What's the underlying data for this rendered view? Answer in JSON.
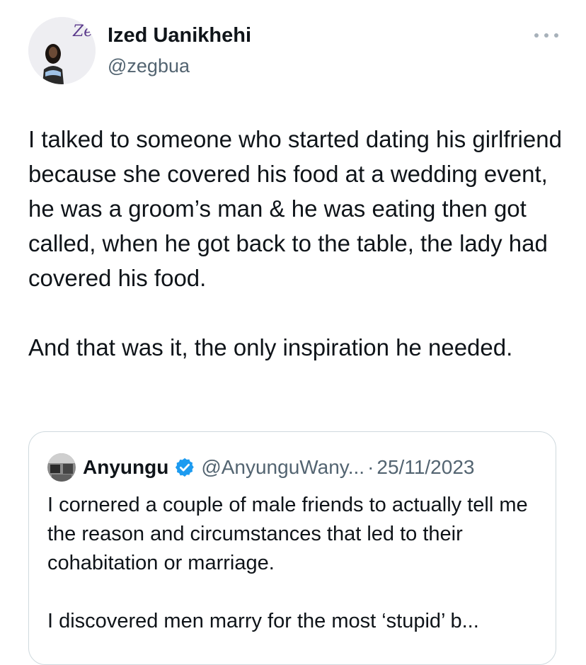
{
  "tweet": {
    "display_name": "Ized Uanikhehi",
    "handle": "@zegbua",
    "avatar_logo_text": "Zedi",
    "paragraphs": [
      "I talked to someone who started dating his girlfriend because she covered his food at a wedding event, he was a groom’s man & he was eating then got called, when he got back to the table, the lady had covered his food.",
      "And that was it, the only inspiration he needed."
    ],
    "more_icon": "more-horizontal-icon"
  },
  "quoted_tweet": {
    "display_name": "Anyungu",
    "verified_icon": "verified-badge-icon",
    "handle": "@AnyunguWany...",
    "separator": "·",
    "date": "25/11/2023",
    "paragraphs": [
      "I cornered a couple of male friends to actually tell me the reason and circumstances that led to their cohabitation or marriage.",
      "I discovered men marry for the most ‘stupid’ b..."
    ]
  },
  "colors": {
    "text_primary": "#0f1419",
    "text_secondary": "#536471",
    "border": "#cfd9de",
    "verified_blue": "#1d9bf0"
  }
}
